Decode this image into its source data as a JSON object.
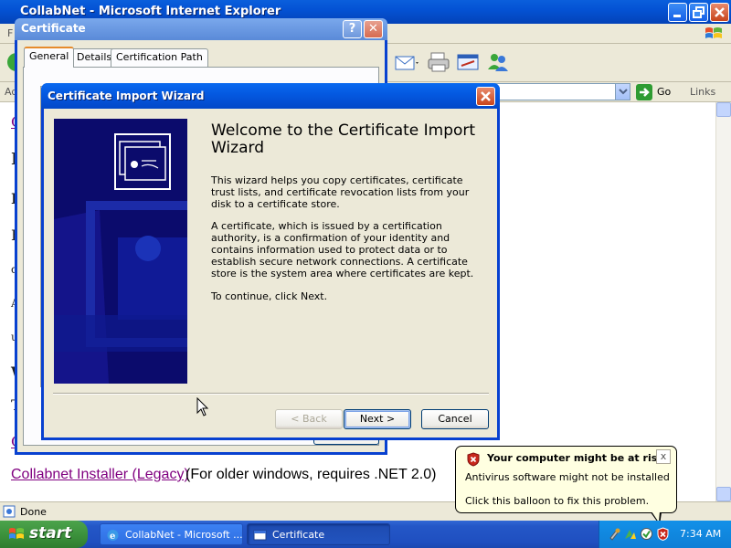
{
  "ie": {
    "title": "CollabNet - Microsoft Internet Explorer",
    "menu_letter": "F",
    "address_label": "Ad",
    "go_label": "Go",
    "links_label": "Links",
    "status_text": "Done",
    "page": {
      "edge_chars": [
        "C",
        "I",
        "I",
        "F",
        "d",
        "A",
        "u",
        "W",
        "T",
        "C"
      ],
      "link_text": "Collabnet Installer (Legacy)",
      "link_suffix": "(For older windows, requires .NET 2.0)"
    }
  },
  "certificate": {
    "title": "Certificate",
    "help_label": "?",
    "close_label": "✕",
    "tabs": [
      {
        "label": "General",
        "active": true
      },
      {
        "label": "Details",
        "active": false
      },
      {
        "label": "Certification Path",
        "active": false
      }
    ]
  },
  "wizard": {
    "title": "Certificate Import Wizard",
    "close_label": "✕",
    "heading": "Welcome to the Certificate Import Wizard",
    "paragraphs": [
      "This wizard helps you copy certificates, certificate trust lists, and certificate revocation lists from your disk to a certificate store.",
      "A certificate, which is issued by a certification authority, is a confirmation of your identity and contains information used to protect data or to establish secure network connections. A certificate store is the system area where certificates are kept.",
      "To continue, click Next."
    ],
    "buttons": {
      "back": "< Back",
      "next": "Next >",
      "cancel": "Cancel"
    }
  },
  "taskbar": {
    "start_label": "start",
    "tasks": [
      {
        "label": "CollabNet - Microsoft ...",
        "active": false
      },
      {
        "label": "Certificate",
        "active": true
      }
    ],
    "clock": "7:34 AM"
  },
  "balloon": {
    "title": "Your computer might be at risk",
    "line1": "Antivirus software might not be installed",
    "line2": "Click this balloon to fix this problem.",
    "close_label": "x"
  },
  "colors": {
    "xp_blue": "#0458e0",
    "link_visited": "#800080",
    "balloon_bg": "#ffffe1",
    "start_green": "#3c923c"
  }
}
